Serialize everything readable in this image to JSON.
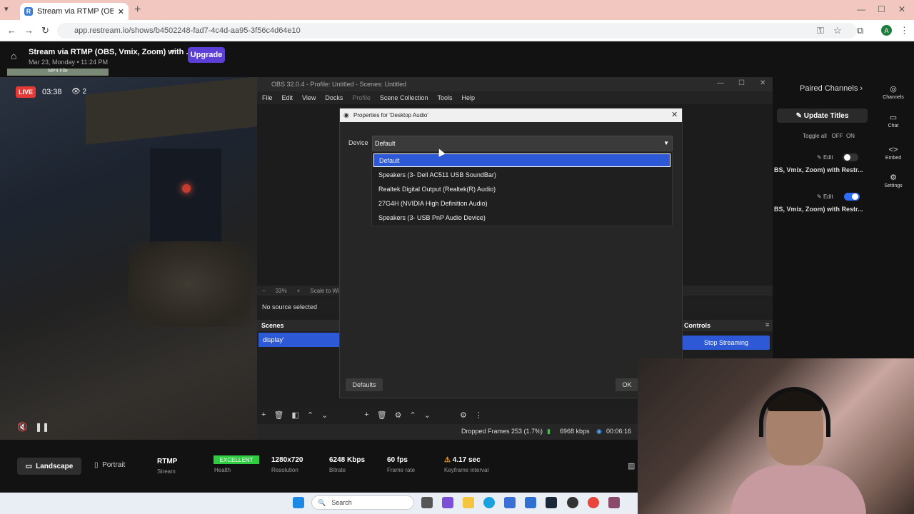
{
  "browser": {
    "tab_title": "Stream via RTMP (OBS, Vmix, Z",
    "tab_favicon": "R",
    "url": "app.restream.io/shows/b4502248-fad7-4c4d-aa95-3f56c4d64e10",
    "profile_initial": "A"
  },
  "header": {
    "stream_title": "Stream via RTMP (OBS, Vmix, Zoom) with ...",
    "date": "Mar 23, Monday • 11:24 PM",
    "upgrade_label": "Upgrade",
    "mp4_label": "MP4 File"
  },
  "preview": {
    "live_label": "LIVE",
    "timer": "03:38",
    "viewers": "2"
  },
  "obs": {
    "title": "OBS 32.0.4 - Profile: Untitled - Scenes: Untitled",
    "menu": [
      "File",
      "Edit",
      "View",
      "Docks",
      "Profile",
      "Scene Collection",
      "Tools",
      "Help"
    ],
    "zoom": "33%",
    "scale_label": "Scale to Windo",
    "no_source": "No source selected",
    "scenes_header": "Scenes",
    "scene_item": "display'",
    "controls_header": "Controls",
    "stop_streaming": "Stop Streaming",
    "dropped_frames": "Dropped Frames 253 (1.7%)",
    "bitrate": "6968 kbps",
    "duration": "00:06:16"
  },
  "dialog": {
    "title": "Properties for 'Desktop Audio'",
    "device_label": "Device",
    "device_value": "Default",
    "options": [
      "Default",
      "Speakers (3- Dell AC511 USB SoundBar)",
      "Realtek Digital Output (Realtek(R) Audio)",
      "27G4H (NVIDIA High Definition Audio)",
      "Speakers (3- USB PnP Audio Device)"
    ],
    "defaults_label": "Defaults",
    "ok_label": "OK"
  },
  "right_panel": {
    "paired_channels": "Paired Channels",
    "update_titles": "Update Titles",
    "toggle_all": "Toggle all",
    "off": "OFF",
    "on": "ON",
    "edit": "Edit",
    "channel_title_1": "BS, Vmix, Zoom) with Restr...",
    "channel_title_2": "BS, Vmix, Zoom) with Restr...",
    "nav": [
      "Channels",
      "Chat",
      "Embed",
      "Settings"
    ]
  },
  "stats": {
    "landscape": "Landscape",
    "portrait": "Portrait",
    "protocol": "RTMP",
    "protocol_label": "Stream",
    "health_badge": "EXCELLENT",
    "health_label": "Health",
    "resolution": "1280x720",
    "resolution_label": "Resolution",
    "bitrate": "6248 Kbps",
    "bitrate_label": "Bitrate",
    "fps": "60 fps",
    "fps_label": "Frame rate",
    "keyframe": "4.17 sec",
    "keyframe_label": "Keyframe interval"
  },
  "taskbar": {
    "search_placeholder": "Search"
  },
  "colors": {
    "accent": "#2d59d6",
    "live": "#e53935",
    "upgrade": "#5b3fd6",
    "excellent": "#2ecc40",
    "tabbar": "#f2c7bf"
  }
}
